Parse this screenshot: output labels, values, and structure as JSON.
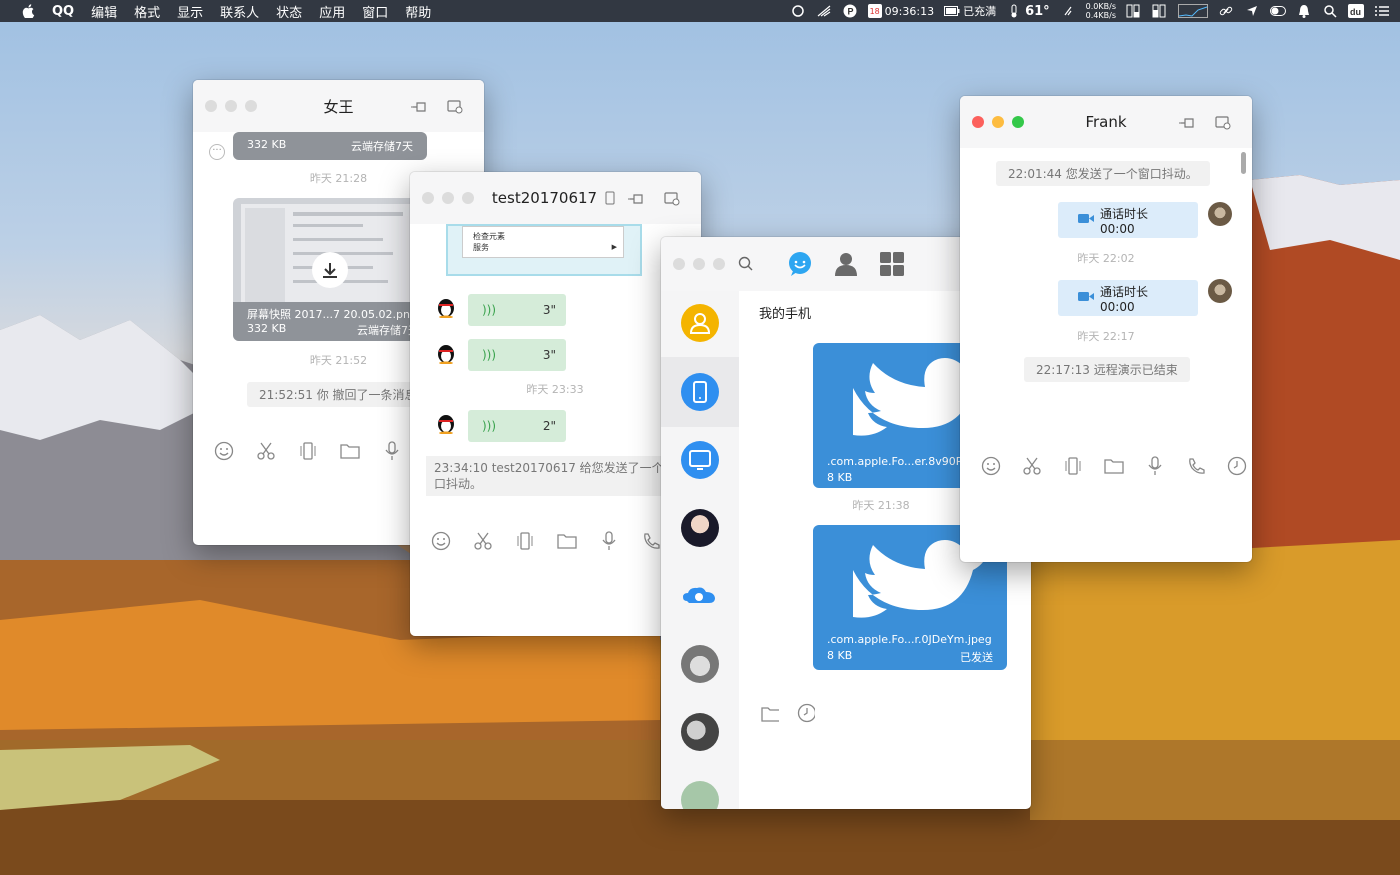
{
  "menubar": {
    "app": "QQ",
    "items": [
      "编辑",
      "格式",
      "显示",
      "联系人",
      "状态",
      "应用",
      "窗口",
      "帮助"
    ],
    "calendar_day": "18",
    "time": "09:36:13",
    "battery": "已充满",
    "temp": "61°",
    "net_up": "0.0KB/s",
    "net_down": "0.4KB/s"
  },
  "win_queen": {
    "title": "女王",
    "file1_size": "332 KB",
    "file1_status": "云端存储7天",
    "ts1": "昨天  21:28",
    "file2_name": "屏幕快照 2017...7 20.05.02.png",
    "file2_size": "332 KB",
    "file2_status": "云端存储7天",
    "ts2": "昨天  21:52",
    "sys": "21:52:51 你 撤回了一条消息"
  },
  "win_test": {
    "title": "test20170617",
    "menu_item1": "检查元素",
    "menu_item2": "服务",
    "voice": [
      "3\"",
      "3\"",
      "2\""
    ],
    "ts": "昨天  23:33",
    "sys_line1": "23:34:10 test20170617 给您发送了一个窗",
    "sys_line2": "口抖动。"
  },
  "win_main": {
    "header": "我的手机",
    "file1_name": ".com.apple.Fo...er.8v90R",
    "file1_size": "8 KB",
    "ts": "昨天  21:38",
    "file2_name": ".com.apple.Fo...r.0JDeYm.jpeg",
    "file2_size": "8 KB",
    "file2_status": "已发送"
  },
  "win_frank": {
    "title": "Frank",
    "sys1": "22:01:44 您发送了一个窗口抖动。",
    "call1": "通话时长 00:00",
    "ts1": "昨天  22:02",
    "call2": "通话时长 00:00",
    "ts2": "昨天  22:17",
    "sys2": "22:17:13 远程演示已结束"
  },
  "colors": {
    "accent": "#3b8fd8",
    "voice_bg": "#d5ecd9",
    "call_bg": "#dcecfa"
  }
}
